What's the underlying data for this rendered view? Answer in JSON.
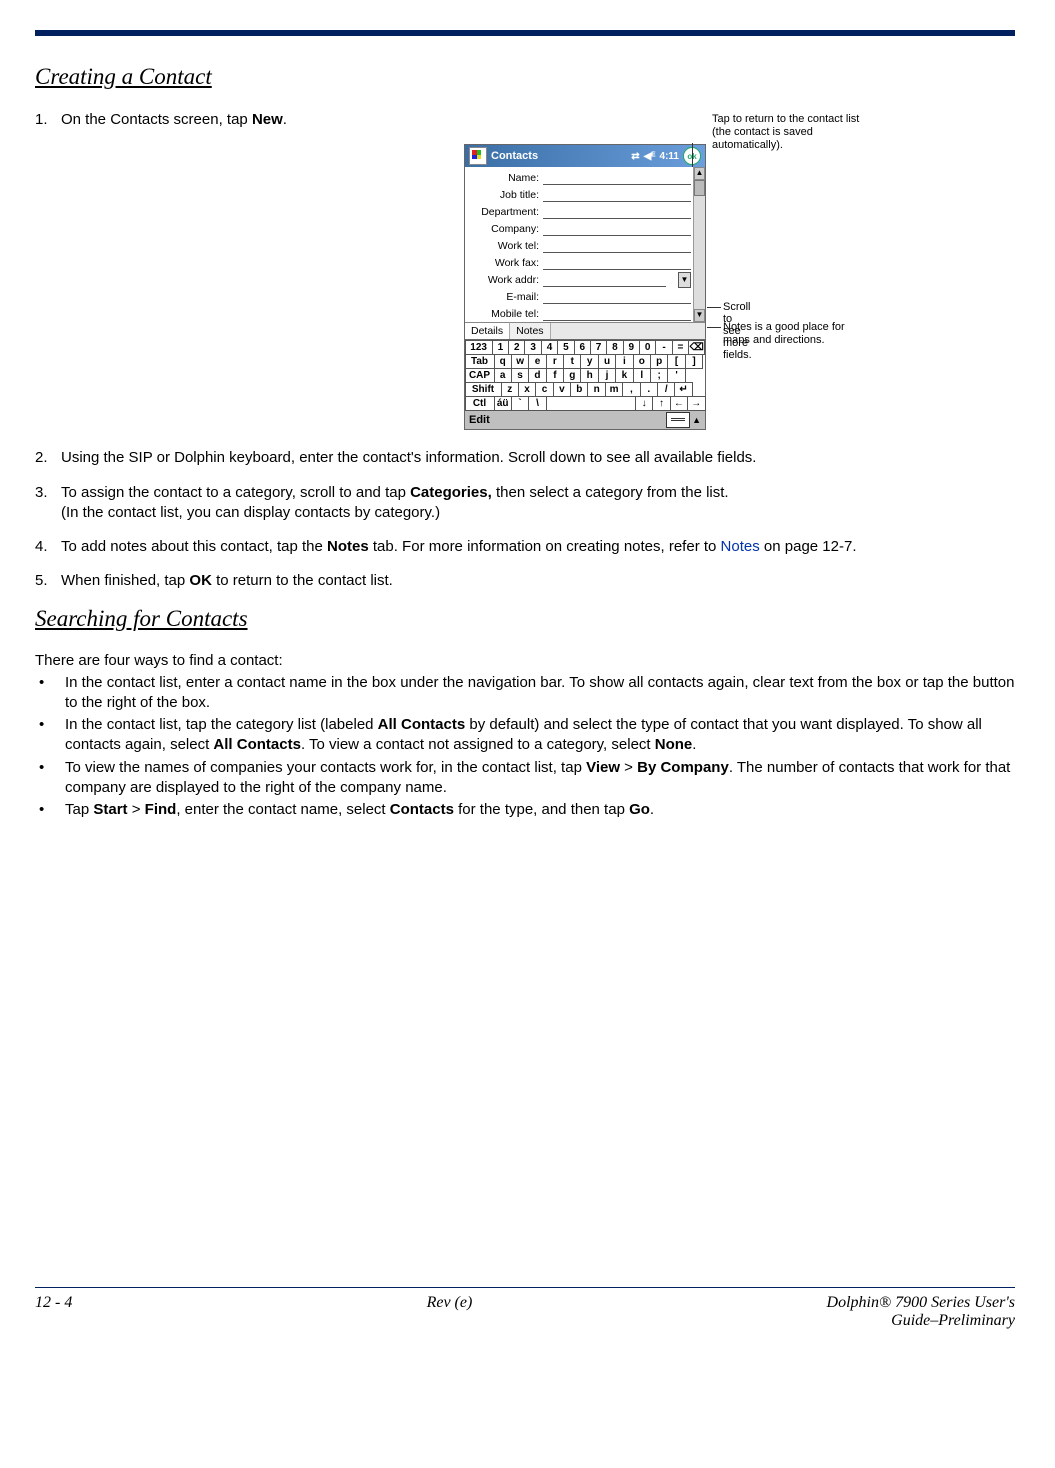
{
  "section1": {
    "heading": "Creating a Contact"
  },
  "steps": {
    "s1": {
      "num": "1.",
      "pre": "On the Contacts screen, tap ",
      "bold": "New",
      "post": "."
    },
    "s2": {
      "num": "2.",
      "text": "Using the SIP or Dolphin keyboard, enter the contact's information. Scroll down to see all available fields."
    },
    "s3": {
      "num": "3.",
      "pre": "To assign the contact to a category, scroll to and tap ",
      "bold": "Categories,",
      "post": " then select a category from the list.",
      "sub": "(In the contact list, you can display contacts by category.)"
    },
    "s4": {
      "num": "4.",
      "pre": "To add notes about this contact, tap the ",
      "bold": "Notes",
      "post1": " tab. For more information on creating notes, refer to ",
      "link": "Notes",
      "post2": " on page 12-7."
    },
    "s5": {
      "num": "5.",
      "pre": "When finished, tap ",
      "bold": "OK",
      "post": " to return to the contact list."
    }
  },
  "section2": {
    "heading": "Searching for Contacts",
    "intro": "There are four ways to find a contact:"
  },
  "bullets": {
    "b1": "In the contact list, enter a contact name in the box under the navigation bar. To show all contacts again, clear text from the box or tap the button to the right of the box.",
    "b2": {
      "pre": "In the contact list, tap the category list (labeled ",
      "bold1": "All Contacts",
      "mid1": " by default) and select the type of contact that you want displayed. To show all contacts again, select ",
      "bold2": "All Contacts",
      "mid2": ". To view a contact not assigned to a category, select ",
      "bold3": "None",
      "post": "."
    },
    "b3": {
      "pre": "To view the names of companies your contacts work for, in the contact list, tap ",
      "bold1": "View",
      "gt1": " > ",
      "bold2": "By Company",
      "post": ". The number of contacts that work for that company are displayed to the right of the company name."
    },
    "b4": {
      "pre": "Tap ",
      "bold1": "Start",
      "gt1": " > ",
      "bold2": "Find",
      "mid1": ", enter the contact name, select ",
      "bold3": "Contacts",
      "mid2": " for the type, and then tap ",
      "bold4": "Go",
      "post": "."
    }
  },
  "device": {
    "callout_top": "Tap to return to the contact list (the contact is saved automatically).",
    "callout_scroll": "Scroll to see more fields.",
    "callout_notes": "Notes is a good place for maps and directions.",
    "title": "Contacts",
    "time": "4:11",
    "ok": "ok",
    "fields": [
      "Name:",
      "Job title:",
      "Department:",
      "Company:",
      "Work tel:",
      "Work fax:",
      "Work addr:",
      "E-mail:",
      "Mobile tel:"
    ],
    "tab_details": "Details",
    "tab_notes": "Notes",
    "kbd_rows": {
      "r1": [
        "123",
        "1",
        "2",
        "3",
        "4",
        "5",
        "6",
        "7",
        "8",
        "9",
        "0",
        "-",
        "=",
        "⌫"
      ],
      "r2": [
        "Tab",
        "q",
        "w",
        "e",
        "r",
        "t",
        "y",
        "u",
        "i",
        "o",
        "p",
        "[",
        "]"
      ],
      "r3": [
        "CAP",
        "a",
        "s",
        "d",
        "f",
        "g",
        "h",
        "j",
        "k",
        "l",
        ";",
        "'"
      ],
      "r4": [
        "Shift",
        "z",
        "x",
        "c",
        "v",
        "b",
        "n",
        "m",
        ",",
        ".",
        "/",
        "↵"
      ],
      "r5": [
        "Ctl",
        "áü",
        "`",
        "\\",
        " ",
        "↓",
        "↑",
        "←",
        "→"
      ]
    },
    "edit": "Edit"
  },
  "footer": {
    "left": "12 - 4",
    "center": "Rev (e)",
    "right1": "Dolphin® 7900 Series User's",
    "right2": "Guide–Preliminary"
  }
}
